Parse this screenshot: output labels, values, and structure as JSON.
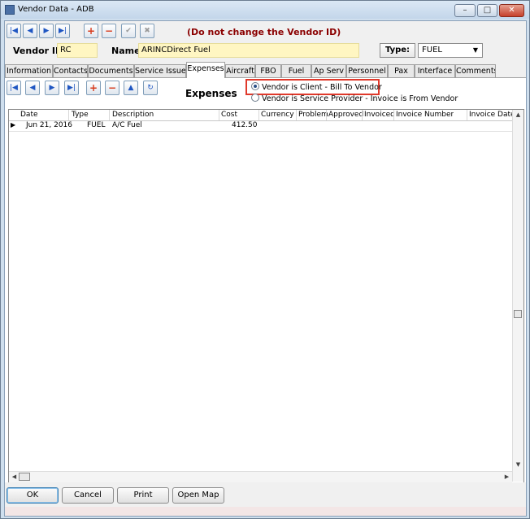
{
  "window": {
    "title": "Vendor Data - ADB",
    "minimize_glyph": "–",
    "maximize_glyph": "□",
    "close_glyph": "✕"
  },
  "toolbar": {
    "buttons": [
      {
        "icon": "first-record-icon",
        "glyph": "|◀"
      },
      {
        "icon": "previous-record-icon",
        "glyph": "◀"
      },
      {
        "icon": "next-record-icon",
        "glyph": "▶"
      },
      {
        "icon": "last-record-icon",
        "glyph": "▶|"
      },
      {
        "icon": "add-record-icon",
        "glyph": "+"
      },
      {
        "icon": "delete-record-icon",
        "glyph": "−"
      },
      {
        "icon": "save-check-icon",
        "glyph": "✔"
      },
      {
        "icon": "cancel-x-icon",
        "glyph": "✖"
      }
    ],
    "warning": "(Do not change the Vendor ID)"
  },
  "vendor": {
    "id_label": "Vendor ID:",
    "id_value": "RC",
    "name_label": "Name:",
    "name_value": "ARINCDirect Fuel",
    "type_button": "Type:",
    "type_value": "FUEL",
    "type_caret": "▼"
  },
  "tabs": [
    {
      "label": "Information",
      "active": false
    },
    {
      "label": "Contacts",
      "active": false
    },
    {
      "label": "Documents",
      "active": false
    },
    {
      "label": "Service Issues",
      "active": false
    },
    {
      "label": "Expenses",
      "active": true
    },
    {
      "label": "Aircraft",
      "active": false
    },
    {
      "label": "FBO",
      "active": false
    },
    {
      "label": "Fuel",
      "active": false
    },
    {
      "label": "Ap Serv",
      "active": false
    },
    {
      "label": "Personnel",
      "active": false
    },
    {
      "label": "Pax",
      "active": false
    },
    {
      "label": "Interface",
      "active": false
    },
    {
      "label": "Comments",
      "active": false
    }
  ],
  "expenses": {
    "title": "Expenses",
    "nav_buttons": [
      {
        "icon": "first-record-icon",
        "glyph": "|◀"
      },
      {
        "icon": "previous-record-icon",
        "glyph": "◀"
      },
      {
        "icon": "next-record-icon",
        "glyph": "▶"
      },
      {
        "icon": "last-record-icon",
        "glyph": "▶|"
      },
      {
        "icon": "add-record-icon",
        "glyph": "+"
      },
      {
        "icon": "delete-record-icon",
        "glyph": "−"
      },
      {
        "icon": "move-up-icon",
        "glyph": "▲"
      },
      {
        "icon": "refresh-icon",
        "glyph": "↻"
      }
    ],
    "radio_client": "Vendor is Client - Bill To Vendor",
    "radio_provider": "Vendor is Service Provider - Invoice is From Vendor",
    "selected": "client",
    "columns": [
      "Date",
      "Type",
      "Description",
      "Cost",
      "Currency",
      "Problem",
      "Approved",
      "Invoiced",
      "Invoice Number",
      "Invoice Date I"
    ],
    "rows": [
      {
        "indicator": "▶",
        "date": "Jun 21, 2016",
        "type": "FUEL",
        "description": "A/C Fuel",
        "cost": "412.50"
      }
    ]
  },
  "scroll": {
    "up": "▲",
    "down": "▼",
    "left": "◀",
    "right": "▶"
  },
  "buttons": {
    "ok": "OK",
    "cancel": "Cancel",
    "print": "Print",
    "open_map": "Open Map"
  },
  "colors": {
    "field_bg": "#fff6c2",
    "highlight": "#e0392b",
    "warning_text": "#8b0000"
  }
}
